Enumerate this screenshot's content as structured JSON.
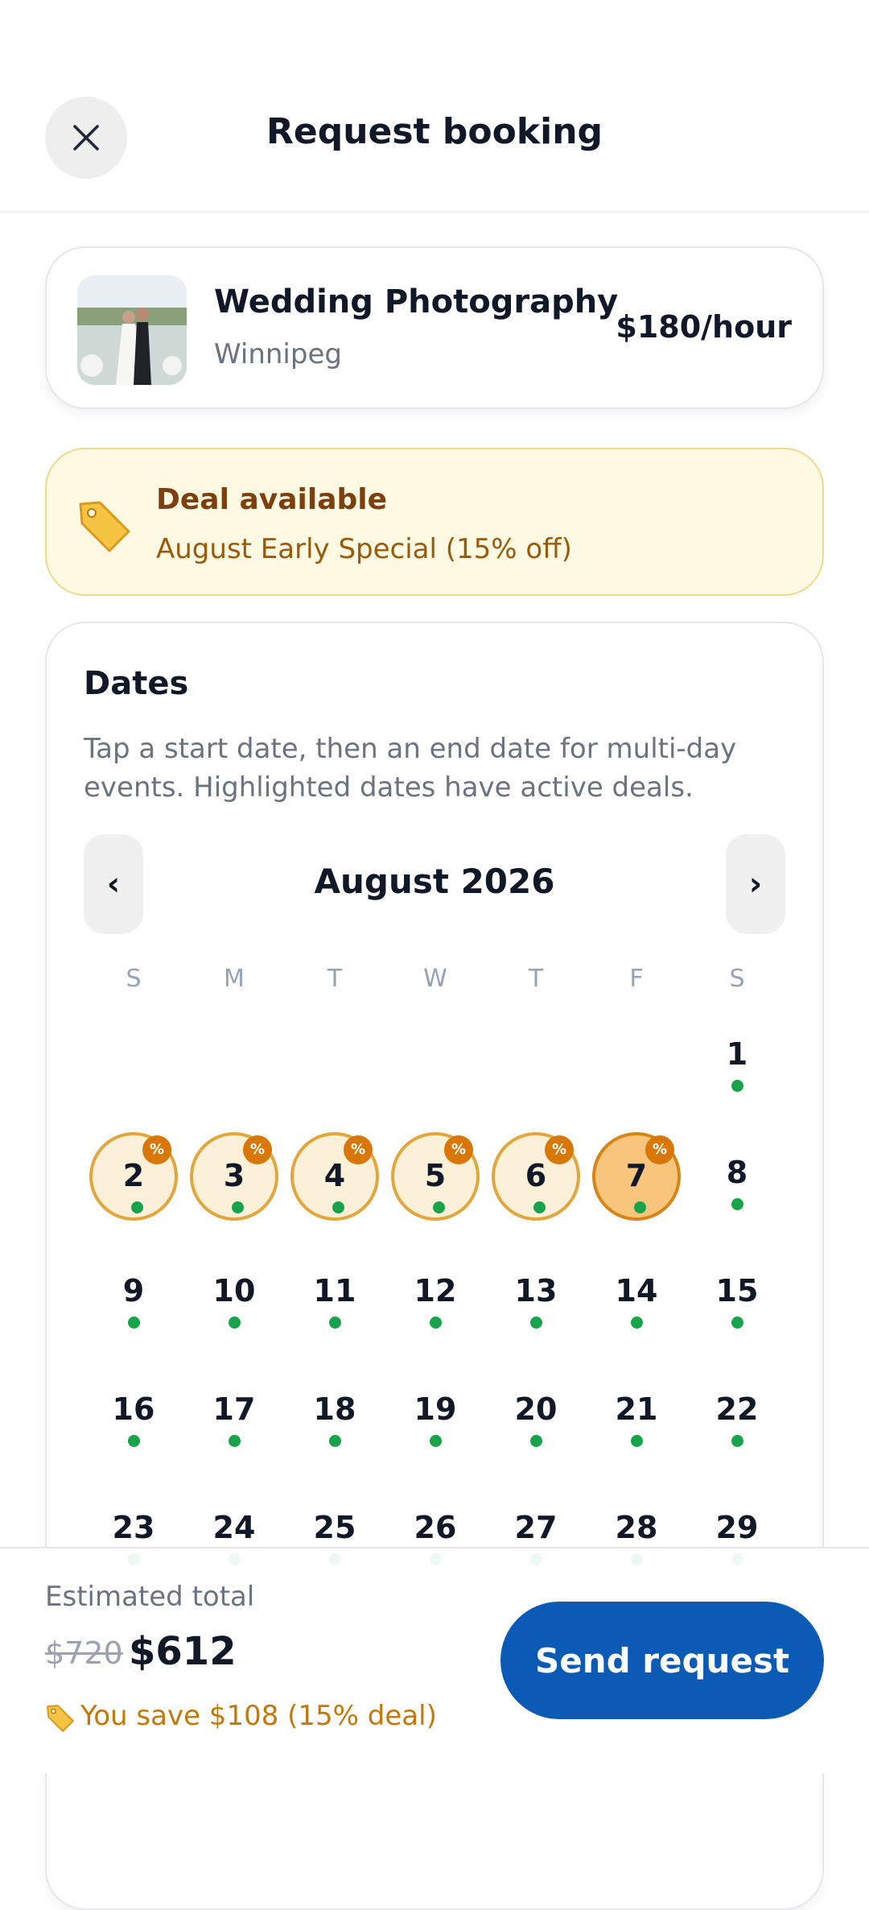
{
  "header": {
    "title": "Request booking",
    "close_icon": "close-icon"
  },
  "service": {
    "title": "Wedding Photography",
    "location": "Winnipeg",
    "price": "$180/hour",
    "thumbnail": "wedding-couple-photo"
  },
  "deal": {
    "icon": "price-tag-icon",
    "title": "Deal available",
    "description": "August Early Special (15% off)"
  },
  "dates": {
    "title": "Dates",
    "description": "Tap a start date, then an end date for multi-day events. Highlighted dates have active deals.",
    "month_label": "August 2026",
    "prev_label": "‹",
    "next_label": "›",
    "weekdays": [
      "S",
      "M",
      "T",
      "W",
      "T",
      "F",
      "S"
    ],
    "deal_badge": "%",
    "days": [
      {
        "num": "1",
        "deal": false,
        "selected": false
      },
      {
        "num": "2",
        "deal": true,
        "selected": false
      },
      {
        "num": "3",
        "deal": true,
        "selected": false
      },
      {
        "num": "4",
        "deal": true,
        "selected": false
      },
      {
        "num": "5",
        "deal": true,
        "selected": false
      },
      {
        "num": "6",
        "deal": true,
        "selected": false
      },
      {
        "num": "7",
        "deal": true,
        "selected": true
      },
      {
        "num": "8",
        "deal": false,
        "selected": false
      },
      {
        "num": "9",
        "deal": false,
        "selected": false
      },
      {
        "num": "10",
        "deal": false,
        "selected": false
      },
      {
        "num": "11",
        "deal": false,
        "selected": false
      },
      {
        "num": "12",
        "deal": false,
        "selected": false
      },
      {
        "num": "13",
        "deal": false,
        "selected": false
      },
      {
        "num": "14",
        "deal": false,
        "selected": false
      },
      {
        "num": "15",
        "deal": false,
        "selected": false
      },
      {
        "num": "16",
        "deal": false,
        "selected": false
      },
      {
        "num": "17",
        "deal": false,
        "selected": false
      },
      {
        "num": "18",
        "deal": false,
        "selected": false
      },
      {
        "num": "19",
        "deal": false,
        "selected": false
      },
      {
        "num": "20",
        "deal": false,
        "selected": false
      },
      {
        "num": "21",
        "deal": false,
        "selected": false
      },
      {
        "num": "22",
        "deal": false,
        "selected": false
      },
      {
        "num": "23",
        "deal": false,
        "selected": false
      },
      {
        "num": "24",
        "deal": false,
        "selected": false
      },
      {
        "num": "25",
        "deal": false,
        "selected": false
      },
      {
        "num": "26",
        "deal": false,
        "selected": false
      },
      {
        "num": "27",
        "deal": false,
        "selected": false
      },
      {
        "num": "28",
        "deal": false,
        "selected": false
      },
      {
        "num": "29",
        "deal": false,
        "selected": false
      }
    ],
    "available_color": "#16a34a",
    "deal_color": "#e1a63c"
  },
  "footer": {
    "estimate_label": "Estimated total",
    "original_price": "$720",
    "total_price": "$612",
    "savings_text": "You save $108 (15% deal)",
    "savings_icon": "price-tag-icon",
    "send_label": "Send request",
    "primary_color": "#0b5ab5"
  }
}
